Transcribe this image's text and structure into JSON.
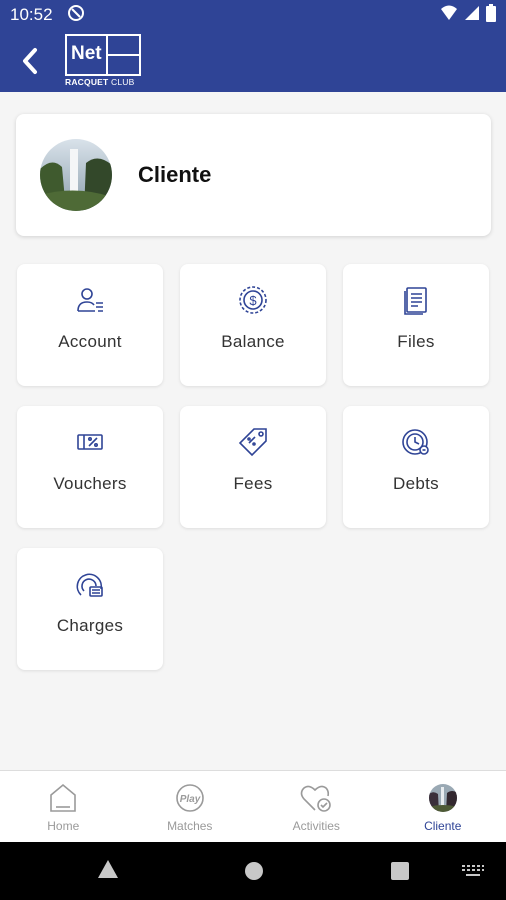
{
  "status": {
    "time": "10:52"
  },
  "header": {
    "logo_text": "Net",
    "logo_sub_bold": "RACQUET",
    "logo_sub": " CLUB"
  },
  "profile": {
    "name": "Cliente"
  },
  "menu": [
    {
      "label": "Account",
      "icon": "account-icon"
    },
    {
      "label": "Balance",
      "icon": "balance-icon"
    },
    {
      "label": "Files",
      "icon": "files-icon"
    },
    {
      "label": "Vouchers",
      "icon": "vouchers-icon"
    },
    {
      "label": "Fees",
      "icon": "fees-icon"
    },
    {
      "label": "Debts",
      "icon": "debts-icon"
    },
    {
      "label": "Charges",
      "icon": "charges-icon"
    }
  ],
  "nav": [
    {
      "label": "Home",
      "icon": "home-icon"
    },
    {
      "label": "Matches",
      "icon": "play-icon"
    },
    {
      "label": "Activities",
      "icon": "heart-check-icon"
    },
    {
      "label": "Cliente",
      "icon": "avatar"
    }
  ],
  "colors": {
    "primary": "#2f4496",
    "icon": "#2f4496",
    "inactive": "#9a9a9a"
  }
}
